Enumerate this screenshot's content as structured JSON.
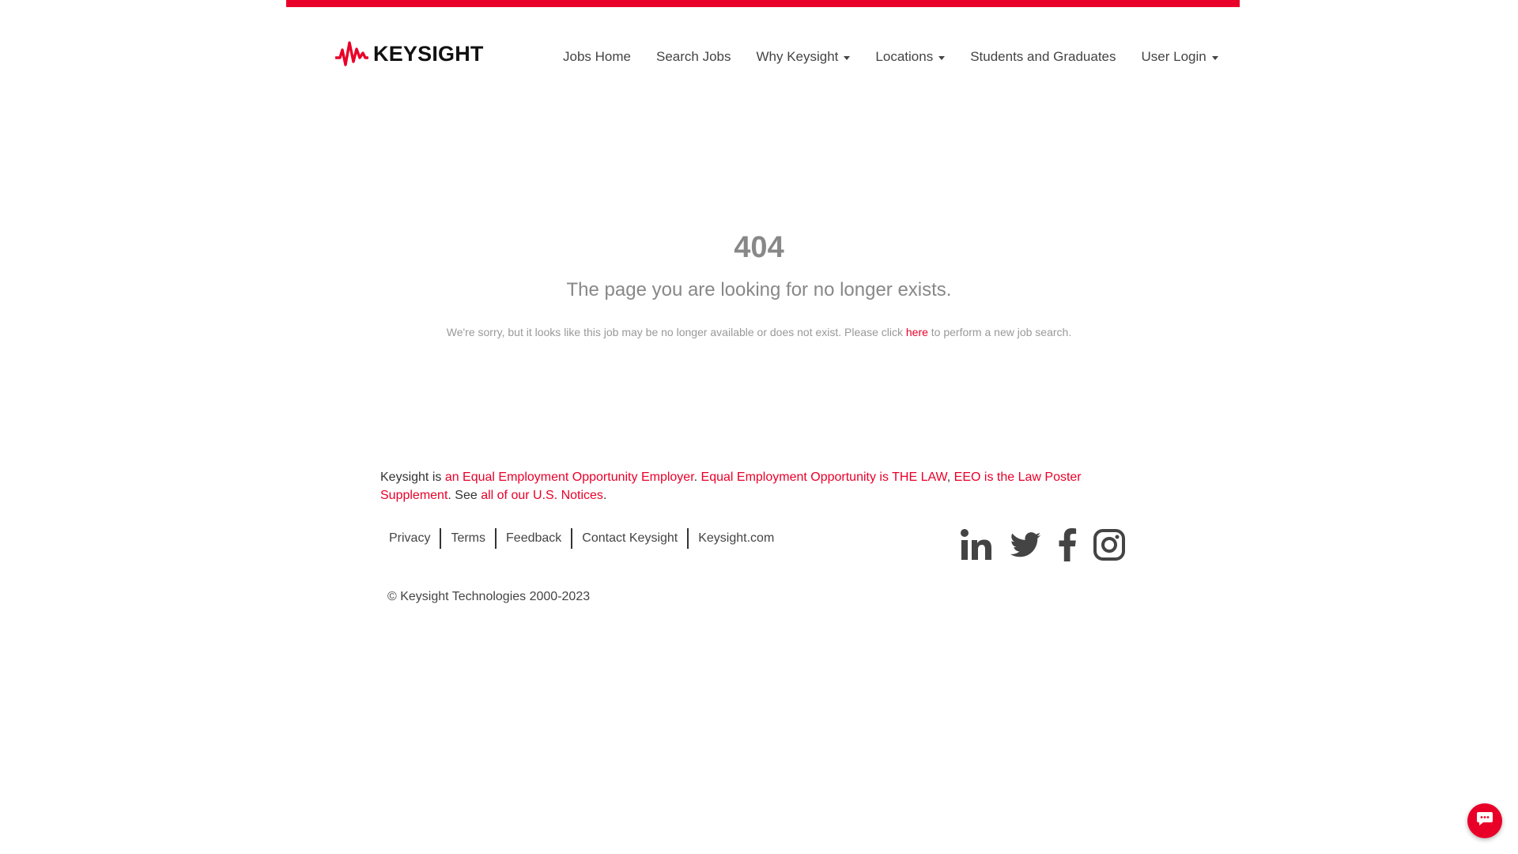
{
  "brand": {
    "name": "KEYSIGHT",
    "accent_color": "#e90029",
    "logo_icon": "keysight-wave-icon"
  },
  "nav": {
    "items": [
      {
        "label": "Jobs Home",
        "dropdown": false
      },
      {
        "label": "Search Jobs",
        "dropdown": false
      },
      {
        "label": "Why Keysight",
        "dropdown": true
      },
      {
        "label": "Locations",
        "dropdown": true
      },
      {
        "label": "Students and Graduates",
        "dropdown": false
      },
      {
        "label": "User Login",
        "dropdown": true
      }
    ]
  },
  "error": {
    "code": "404",
    "title": "The page you are looking for no longer exists.",
    "message_before": "We're sorry, but it looks like this job may be no longer available or does not exist. Please click ",
    "link_text": "here",
    "message_after": " to perform a new job search."
  },
  "eeo": {
    "prefix": "Keysight is ",
    "link1": "an Equal Employment Opportunity Employer",
    "sep1": ". ",
    "link2": "Equal Employment Opportunity is THE LAW",
    "sep2": ", ",
    "link3": "EEO is the Law Poster Supplement",
    "mid": ". See ",
    "link4": "all of our U.S. Notices",
    "end": "."
  },
  "footer": {
    "links": [
      "Privacy",
      "Terms",
      "Feedback",
      "Contact Keysight",
      "Keysight.com"
    ],
    "social_icons": [
      "linkedin-icon",
      "twitter-icon",
      "facebook-icon",
      "instagram-icon"
    ],
    "copyright": "© Keysight Technologies 2000-2023"
  },
  "chat": {
    "icon": "chat-bubble-icon"
  }
}
